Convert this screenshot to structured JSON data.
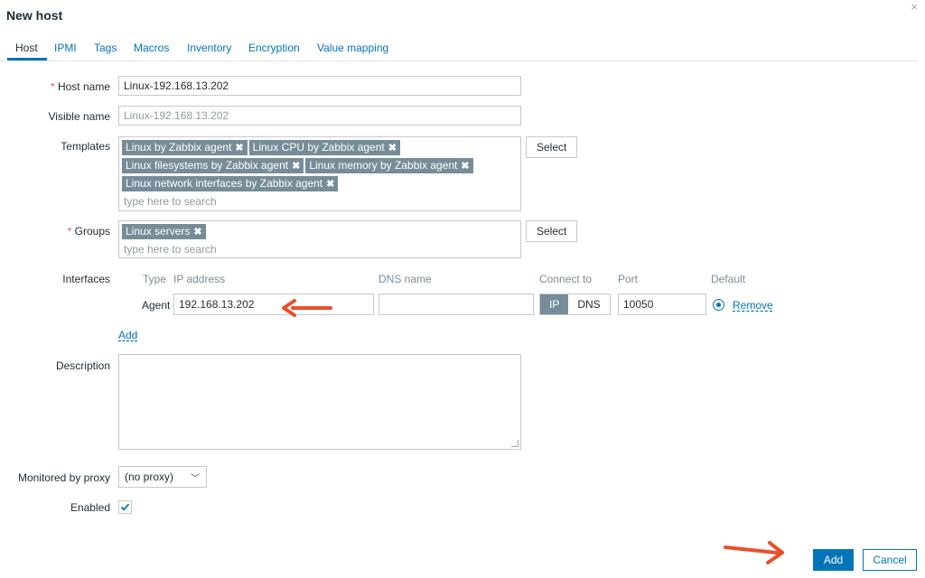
{
  "dialog": {
    "title": "New host",
    "close_glyph": "×"
  },
  "tabs": [
    {
      "label": "Host",
      "active": true
    },
    {
      "label": "IPMI"
    },
    {
      "label": "Tags"
    },
    {
      "label": "Macros"
    },
    {
      "label": "Inventory"
    },
    {
      "label": "Encryption"
    },
    {
      "label": "Value mapping"
    }
  ],
  "form": {
    "required_mark": "*",
    "host_name": {
      "label": "Host name",
      "value": "Linux-192.168.13.202"
    },
    "visible_name": {
      "label": "Visible name",
      "placeholder": "Linux-192.168.13.202"
    },
    "templates": {
      "label": "Templates",
      "tags": [
        "Linux by Zabbix agent",
        "Linux CPU by Zabbix agent",
        "Linux filesystems by Zabbix agent",
        "Linux memory by Zabbix agent",
        "Linux network interfaces by Zabbix agent"
      ],
      "search_placeholder": "type here to search",
      "select_label": "Select"
    },
    "groups": {
      "label": "Groups",
      "tags": [
        "Linux servers"
      ],
      "search_placeholder": "type here to search",
      "select_label": "Select"
    },
    "interfaces": {
      "label": "Interfaces",
      "headers": {
        "type": "Type",
        "ip": "IP address",
        "dns": "DNS name",
        "connect": "Connect to",
        "port": "Port",
        "default": "Default"
      },
      "row": {
        "type": "Agent",
        "ip": "192.168.13.202",
        "dns": "",
        "connect_ip": "IP",
        "connect_dns": "DNS",
        "port": "10050",
        "remove": "Remove"
      },
      "add_label": "Add"
    },
    "description": {
      "label": "Description",
      "value": ""
    },
    "proxy": {
      "label": "Monitored by proxy",
      "value": "(no proxy)"
    },
    "enabled": {
      "label": "Enabled",
      "checked": true
    }
  },
  "footer": {
    "add_label": "Add",
    "cancel_label": "Cancel"
  },
  "colors": {
    "accent": "#0275b8",
    "tag": "#768d99",
    "annotation_arrow": "#e8502a"
  },
  "icons": {
    "close": "close-icon",
    "tag_remove": "remove-tag-icon",
    "chevron": "chevron-down-icon",
    "check": "check-icon",
    "arrow": "annotation-arrow-icon"
  }
}
